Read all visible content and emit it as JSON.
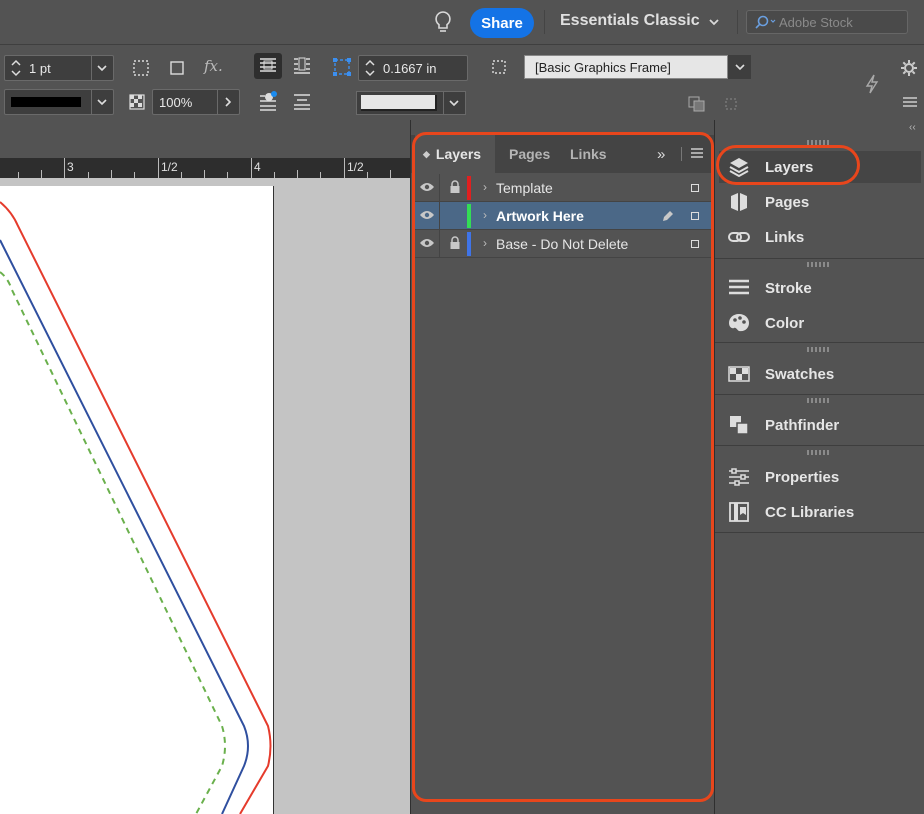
{
  "appbar": {
    "share_label": "Share",
    "workspace": "Essentials Classic",
    "search_placeholder": "Adobe Stock"
  },
  "control": {
    "stroke_weight": "1 pt",
    "opacity": "100%",
    "fx_label": "fx.",
    "frame_offset": "0.1667 in",
    "object_style": "[Basic Graphics Frame]"
  },
  "ruler": {
    "labels": [
      "3",
      "1/2",
      "4",
      "1/2"
    ]
  },
  "layers_panel": {
    "tabs": [
      "Layers",
      "Pages",
      "Links"
    ],
    "layers": [
      {
        "name": "Template",
        "color": "#e02020",
        "locked": true,
        "selected": false
      },
      {
        "name": "Artwork Here",
        "color": "#33dd55",
        "locked": false,
        "selected": true
      },
      {
        "name": "Base - Do Not Delete",
        "color": "#3f74e8",
        "locked": true,
        "selected": false
      }
    ]
  },
  "dock": {
    "items": [
      "Layers",
      "Pages",
      "Links",
      "Stroke",
      "Color",
      "Swatches",
      "Pathfinder",
      "Properties",
      "CC Libraries"
    ]
  },
  "colors": {
    "accent": "#1473e6",
    "highlight": "#e8461c",
    "selection": "#4b6887"
  }
}
